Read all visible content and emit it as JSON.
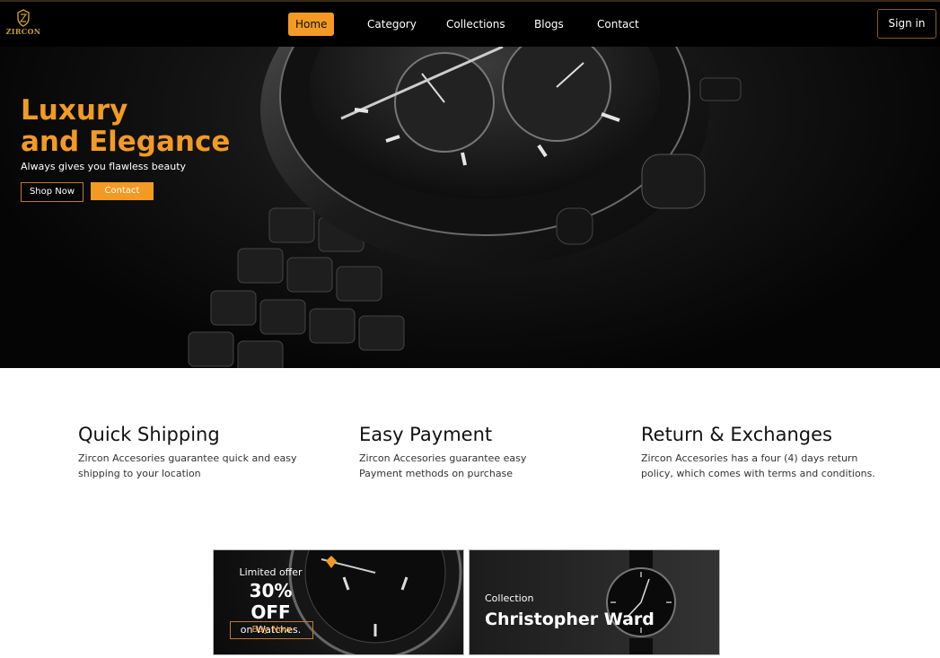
{
  "brand": {
    "logo_text": "ZIRCON"
  },
  "nav": {
    "links": [
      "Home",
      "Category",
      "Collections",
      "Blogs",
      "Contact"
    ],
    "active": "Home",
    "signin_label": "Sign in"
  },
  "hero": {
    "title_line1": "Luxury",
    "title_line2": "and Elegance",
    "subtitle": "Always gives you flawless beauty",
    "shop_label": "Shop Now",
    "contact_label": "Contact"
  },
  "features": [
    {
      "title": "Quick Shipping",
      "text": "Zircon Accesories guarantee quick and easy shipping to your location"
    },
    {
      "title": "Easy Payment",
      "text": "Zircon Accesories guarantee easy Payment methods on purchase"
    },
    {
      "title": "Return & Exchanges",
      "text": "Zircon Accesories has a four (4) days return policy, which comes with terms and conditions."
    }
  ],
  "promo": {
    "offer_small": "Limited offer",
    "offer_big": "30% OFF",
    "offer_on": "on Watches.",
    "buy_label": "Buy Now",
    "collection_small": "Collection",
    "collection_big": "Christopher Ward"
  },
  "colors": {
    "accent": "#f29a24",
    "nav_bg": "#000000",
    "logo_gold": "#c89b3c"
  },
  "icons": {
    "logo": "crest-icon"
  }
}
